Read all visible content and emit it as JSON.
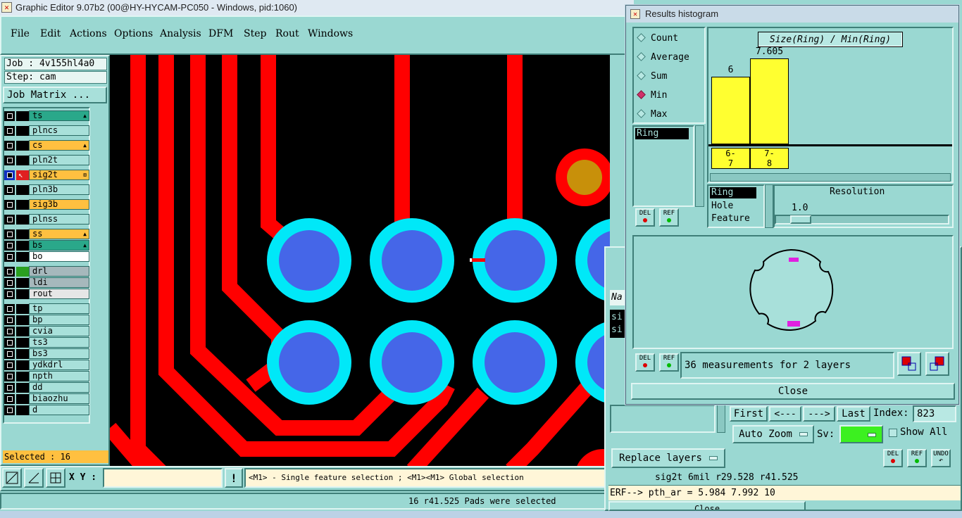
{
  "window": {
    "title": "Graphic Editor 9.07b2 (00@HY-HYCAM-PC050 - Windows, pid:1060)"
  },
  "menu": [
    "File",
    "Edit",
    "Actions",
    "Options",
    "Analysis",
    "DFM",
    "Step",
    "Rout",
    "Windows"
  ],
  "job": {
    "job_label": "Job : 4v155hl4a0",
    "step_label": "Step: cam",
    "matrix_button": "Job Matrix ..."
  },
  "layers": [
    {
      "name": "ts",
      "color": "#2aa88a",
      "mark": "▲"
    },
    {
      "name": "plncs",
      "color": "#a8e0da",
      "mark": ""
    },
    {
      "name": "cs",
      "color": "#ffc040",
      "mark": "▲"
    },
    {
      "name": "pln2t",
      "color": "#a8e0da",
      "mark": ""
    },
    {
      "name": "sig2t",
      "color": "#ffc040",
      "mark": "⊞"
    },
    {
      "name": "pln3b",
      "color": "#a8e0da",
      "mark": ""
    },
    {
      "name": "sig3b",
      "color": "#ffc040",
      "mark": ""
    },
    {
      "name": "plnss",
      "color": "#a8e0da",
      "mark": ""
    },
    {
      "name": "ss",
      "color": "#ffc040",
      "mark": "▲"
    },
    {
      "name": "bs",
      "color": "#2aa88a",
      "mark": "▲"
    },
    {
      "name": "bo",
      "color": "#ffffff",
      "mark": ""
    },
    {
      "name": "drl",
      "color": "#a6b8bc",
      "mark": ""
    },
    {
      "name": "ldi",
      "color": "#a6b8bc",
      "mark": ""
    },
    {
      "name": "rout",
      "color": "#e6e6e6",
      "mark": ""
    },
    {
      "name": "tp",
      "color": "#a8e0da",
      "mark": ""
    },
    {
      "name": "bp",
      "color": "#a8e0da",
      "mark": ""
    },
    {
      "name": "cvia",
      "color": "#a8e0da",
      "mark": ""
    },
    {
      "name": "ts3",
      "color": "#a8e0da",
      "mark": ""
    },
    {
      "name": "bs3",
      "color": "#a8e0da",
      "mark": ""
    },
    {
      "name": "ydkdrl",
      "color": "#a8e0da",
      "mark": ""
    },
    {
      "name": "npth",
      "color": "#a8e0da",
      "mark": ""
    },
    {
      "name": "dd",
      "color": "#a8e0da",
      "mark": ""
    },
    {
      "name": "biaozhu",
      "color": "#a8e0da",
      "mark": ""
    },
    {
      "name": "d",
      "color": "#a8e0da",
      "mark": ""
    }
  ],
  "selected_label": "Selected : 16",
  "bottom": {
    "xy_label": "X Y :",
    "xy_value": "",
    "hint": "<M1> - Single feature selection ; <M1><M1> Global selection",
    "status": "16 r41.525 Pads were selected",
    "bang": "!"
  },
  "histogram": {
    "title": "Results histogram",
    "options": [
      {
        "label": "Count",
        "selected": false
      },
      {
        "label": "Average",
        "selected": false
      },
      {
        "label": "Sum",
        "selected": false
      },
      {
        "label": "Min",
        "selected": true
      },
      {
        "label": "Max",
        "selected": false
      }
    ],
    "list_selected": "Ring",
    "chart_title": "Size(Ring) / Min(Ring)",
    "bar_labels": [
      "6",
      "7.605"
    ],
    "bin_labels": [
      [
        "6-",
        "7"
      ],
      [
        "7-",
        "8"
      ]
    ],
    "categories": [
      "Ring",
      "Hole",
      "Feature"
    ],
    "resolution_label": "Resolution",
    "resolution_value": "1.0",
    "del": "DEL",
    "ref": "REF",
    "measurements": "36 measurements for 2 layers",
    "close": "Close"
  },
  "chart_data": {
    "type": "bar",
    "title": "Size(Ring) / Min(Ring)",
    "categories": [
      "6-7",
      "7-8"
    ],
    "values": [
      6,
      7.605
    ]
  },
  "erf": {
    "first": "First",
    "prev": "<---",
    "next": "--->",
    "last": "Last",
    "index_label": "Index:",
    "index_value": "823",
    "auto_zoom": "Auto Zoom",
    "sv": "Sv:",
    "show_all": "Show All",
    "replace_layers": "Replace layers",
    "undo": "UNDO",
    "info": "sig2t 6mil  r29.528  r41.525",
    "erf_line": "ERF--> pth_ar = 5.984 7.992 10",
    "close": "Close",
    "partial_name": "Na",
    "partial_rows": [
      "si",
      "si"
    ]
  }
}
